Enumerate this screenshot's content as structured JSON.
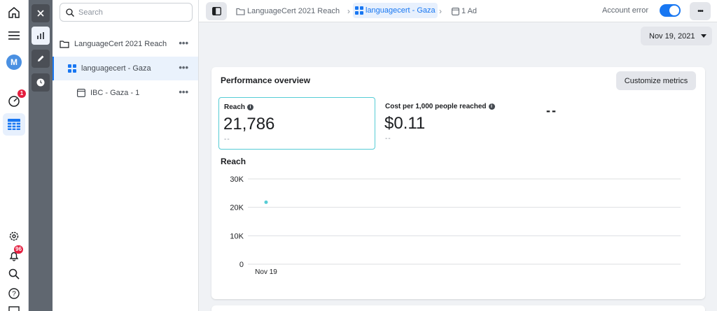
{
  "rail": {
    "avatar_initial": "M",
    "notifications_badge": "1",
    "alerts_badge": "96"
  },
  "search": {
    "placeholder": "Search"
  },
  "tree": {
    "campaign": "LanguageCert 2021 Reach",
    "adset": "languagecert - Gaza",
    "ad": "IBC - Gaza - 1"
  },
  "topbar": {
    "crumb_campaign": "LanguageCert 2021 Reach",
    "crumb_adset": "languagecert - Gaza",
    "crumb_ads": "1 Ad",
    "account_error": "Account error"
  },
  "date_range": "Nov 19, 2021",
  "overview": {
    "title": "Performance overview",
    "customize_label": "Customize metrics",
    "metrics": [
      {
        "label": "Reach",
        "value": "21,786",
        "sub": "-- "
      },
      {
        "label": "Cost per 1,000 people reached",
        "value": "$0.11",
        "sub": "-- "
      }
    ],
    "third_metric_placeholder": "--"
  },
  "chart_data": {
    "type": "scatter",
    "title": "Reach",
    "categories": [
      "Nov 19"
    ],
    "values": [
      21786
    ],
    "ylim": [
      0,
      30000
    ],
    "yticks": [
      "0",
      "10K",
      "20K",
      "30K"
    ],
    "grid": true,
    "series_color": "#56ccd5"
  }
}
